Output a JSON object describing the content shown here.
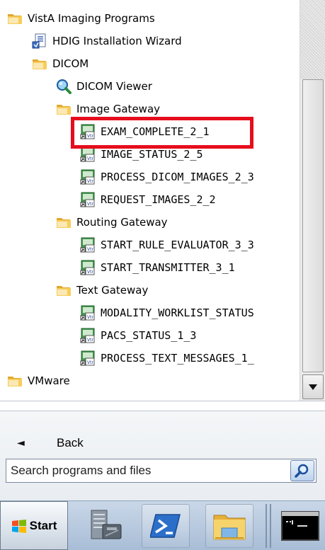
{
  "programs": [
    {
      "key": "vista",
      "label": "VistA Imaging Programs",
      "icon": "folder-icon",
      "level": 0
    },
    {
      "key": "hdig",
      "label": "HDIG Installation Wizard",
      "icon": "installer-icon",
      "level": 1
    },
    {
      "key": "dicom",
      "label": "DICOM",
      "icon": "folder-icon",
      "level": 1
    },
    {
      "key": "dicom-viewer",
      "label": "DICOM Viewer",
      "icon": "magnifier-icon",
      "level": 2
    },
    {
      "key": "image-gateway",
      "label": "Image Gateway",
      "icon": "folder-icon",
      "level": 2
    },
    {
      "key": "exam-complete",
      "label": "EXAM_COMPLETE_2_1",
      "icon": "shortcut-icon",
      "level": 3,
      "highlighted": true
    },
    {
      "key": "image-status",
      "label": "IMAGE_STATUS_2_5",
      "icon": "shortcut-icon",
      "level": 3
    },
    {
      "key": "process-dicom",
      "label": "PROCESS_DICOM_IMAGES_2_3",
      "icon": "shortcut-icon",
      "level": 3
    },
    {
      "key": "request-images",
      "label": "REQUEST_IMAGES_2_2",
      "icon": "shortcut-icon",
      "level": 3
    },
    {
      "key": "routing-gateway",
      "label": "Routing Gateway",
      "icon": "folder-icon",
      "level": 2
    },
    {
      "key": "start-rule",
      "label": "START_RULE_EVALUATOR_3_3",
      "icon": "shortcut-icon",
      "level": 3
    },
    {
      "key": "start-transmitter",
      "label": "START_TRANSMITTER_3_1",
      "icon": "shortcut-icon",
      "level": 3
    },
    {
      "key": "text-gateway",
      "label": "Text Gateway",
      "icon": "folder-icon",
      "level": 2
    },
    {
      "key": "modality-worklist",
      "label": "MODALITY_WORKLIST_STATUS",
      "icon": "shortcut-icon",
      "level": 3
    },
    {
      "key": "pacs-status",
      "label": "PACS_STATUS_1_3",
      "icon": "shortcut-icon",
      "level": 3
    },
    {
      "key": "process-text",
      "label": "PROCESS_TEXT_MESSAGES_1_",
      "icon": "shortcut-icon",
      "level": 3
    },
    {
      "key": "vmware",
      "label": "VMware",
      "icon": "folder-icon",
      "level": 0
    }
  ],
  "back": {
    "label": "Back",
    "icon": "left-arrow-icon"
  },
  "search": {
    "placeholder": "Search programs and files",
    "value": "",
    "button_icon": "search-icon"
  },
  "taskbar": {
    "start_label": "Start",
    "buttons": [
      {
        "name": "server-manager-icon"
      },
      {
        "name": "powershell-icon"
      },
      {
        "name": "explorer-icon"
      },
      {
        "name": "command-prompt-icon"
      }
    ]
  },
  "colors": {
    "highlight": "#e60d1c",
    "folder": "#f2c14e",
    "taskbar": "#b9cbe0"
  }
}
